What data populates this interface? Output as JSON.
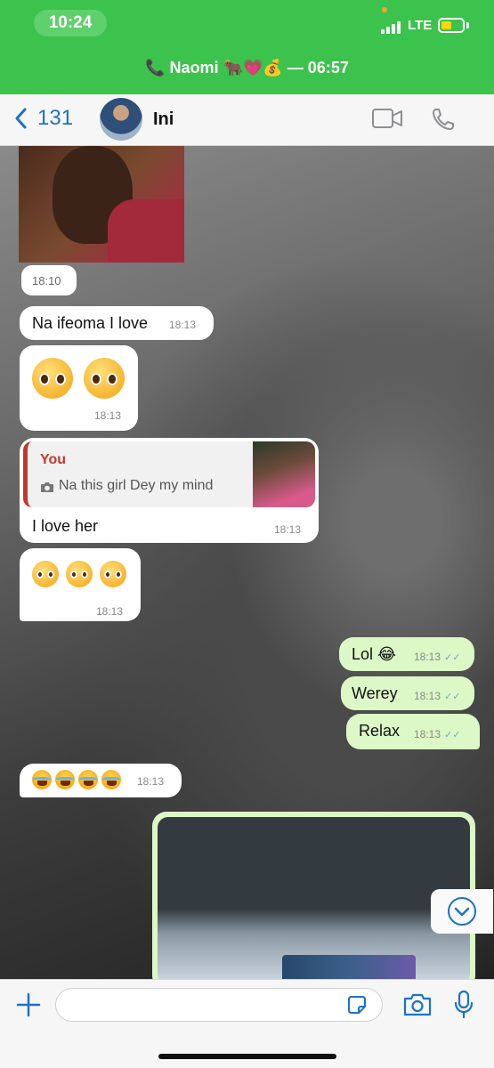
{
  "status_bar": {
    "time": "10:24",
    "network": "LTE"
  },
  "call_banner": {
    "text": "📞 Naomi 🐂💗💰 — 06:57"
  },
  "header": {
    "back_count": "131",
    "contact_name": "Ini"
  },
  "messages": [
    {
      "type": "image",
      "direction": "incoming",
      "time": "18:10"
    },
    {
      "type": "text",
      "direction": "incoming",
      "text": "Na ifeoma I love",
      "time": "18:13"
    },
    {
      "type": "emoji",
      "direction": "incoming",
      "count": 2,
      "emoji": "pleading-face",
      "time": "18:13"
    },
    {
      "type": "reply",
      "direction": "incoming",
      "quote_author": "You",
      "quote_text": "Na this girl Dey my mind",
      "text": "I love her",
      "time": "18:13"
    },
    {
      "type": "emoji",
      "direction": "incoming",
      "count": 3,
      "emoji": "pleading-face",
      "time": "18:13"
    },
    {
      "type": "text",
      "direction": "outgoing",
      "text": "Lol 😂",
      "time": "18:13"
    },
    {
      "type": "text",
      "direction": "outgoing",
      "text": "Werey",
      "time": "18:13"
    },
    {
      "type": "text",
      "direction": "outgoing",
      "text": "Relax",
      "time": "18:13"
    },
    {
      "type": "emoji",
      "direction": "incoming",
      "count": 4,
      "emoji": "face-with-tears-of-joy",
      "time": "18:13"
    },
    {
      "type": "video",
      "direction": "outgoing"
    }
  ],
  "input": {
    "value": "",
    "placeholder": ""
  },
  "colors": {
    "banner": "#3cc34d",
    "outgoing_bubble": "#dcf8c6",
    "accent": "#1a73c9",
    "quote_author": "#c0392b"
  },
  "icons": [
    "phone-icon",
    "chevron-left-icon",
    "video-call-icon",
    "voice-call-icon",
    "camera-icon",
    "sticker-icon",
    "plus-icon",
    "microphone-icon",
    "chevron-down-icon",
    "double-check-icon"
  ]
}
